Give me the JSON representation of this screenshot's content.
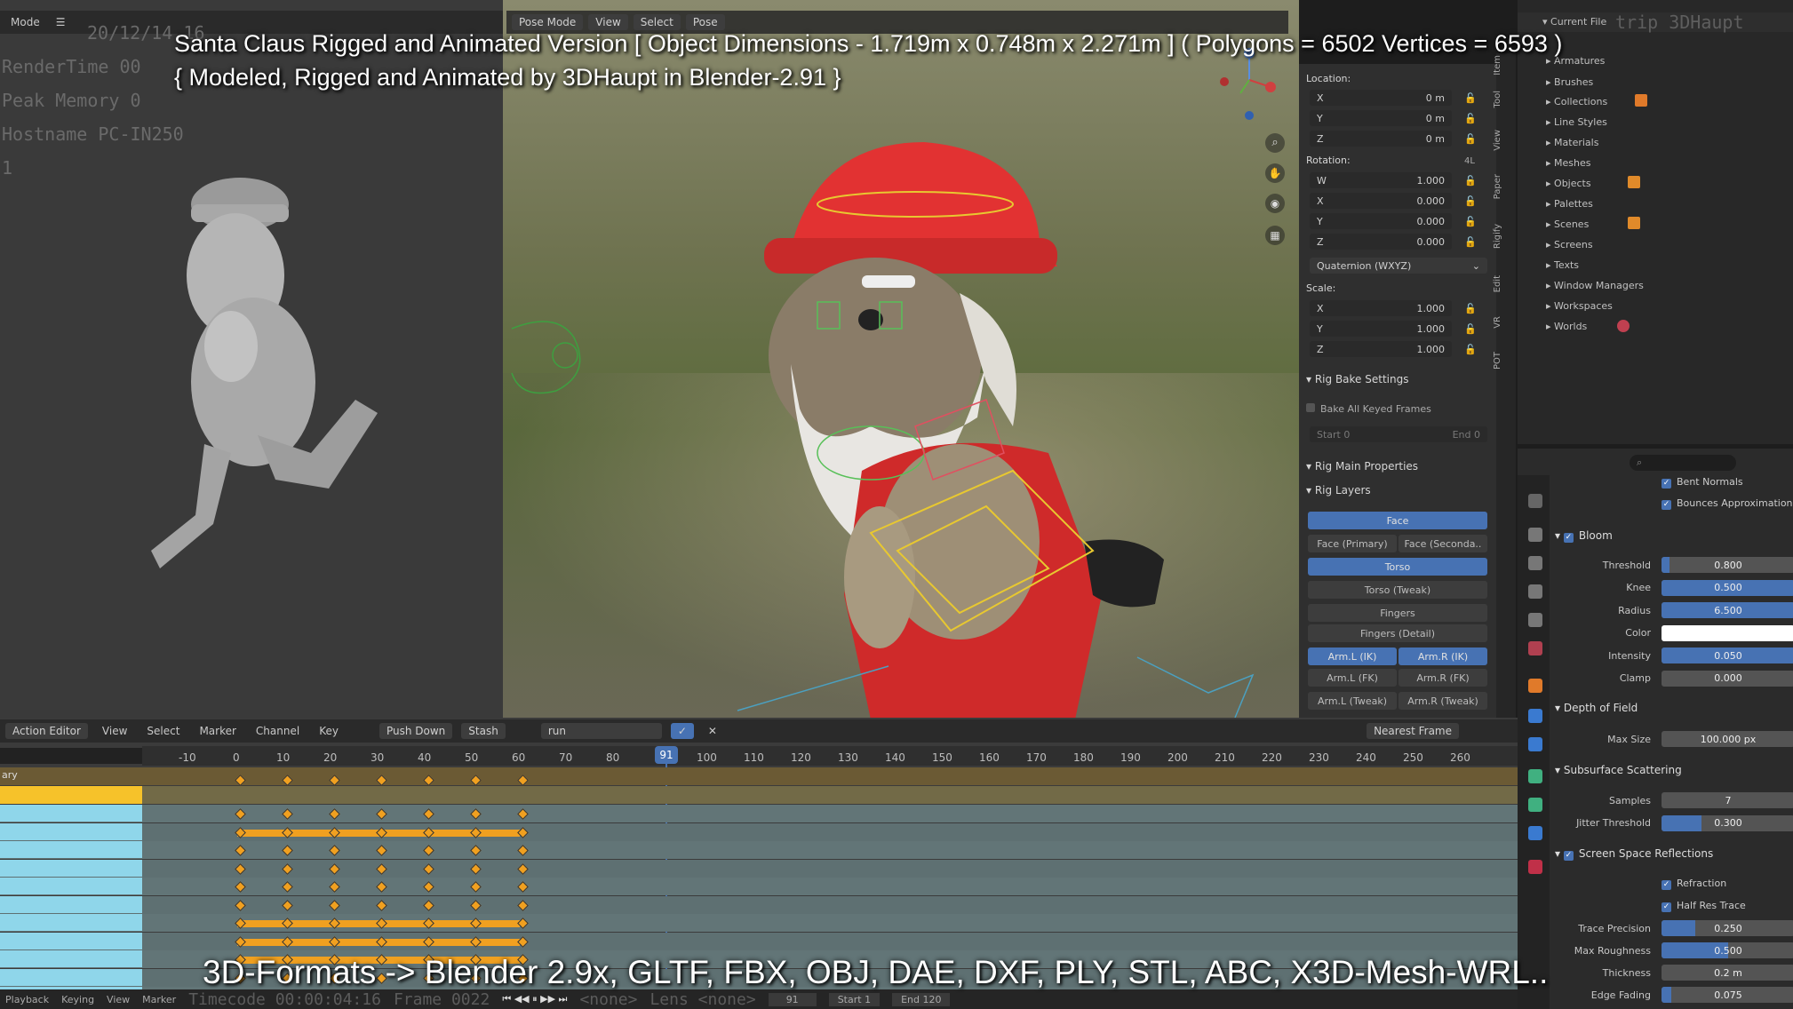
{
  "overlay": {
    "title_line1": "Santa Claus Rigged and Animated Version [ Object Dimensions -  1.719m x 0.748m x 2.271m ] ( Polygons = 6502  Vertices = 6593 )",
    "title_line2": "{ Modeled, Rigged and Animated by 3DHaupt in Blender-2.91 }",
    "formats_line": "3D-Formats -> Blender 2.9x, GLTF, FBX, OBJ, DAE, DXF, PLY, STL, ABC, X3D-Mesh-WRL.."
  },
  "render_stats": {
    "line1": "20/12/14 16",
    "line2": "RenderTime 00",
    "line3": "Peak Memory 0",
    "line4": "Hostname PC-IN250",
    "line5": "1",
    "right_note": "trip 3DHaupt"
  },
  "left_viewport": {
    "mode_label": "Mode"
  },
  "viewport_header": {
    "mode": "Pose Mode",
    "menus": [
      "View",
      "Select",
      "Pose"
    ]
  },
  "npanel": {
    "location_label": "Location:",
    "location": [
      [
        "X",
        "0 m"
      ],
      [
        "Y",
        "0 m"
      ],
      [
        "Z",
        "0 m"
      ]
    ],
    "rotation_label": "Rotation:",
    "rotation_mode_short": "4L",
    "rotation": [
      [
        "W",
        "1.000"
      ],
      [
        "X",
        "0.000"
      ],
      [
        "Y",
        "0.000"
      ],
      [
        "Z",
        "0.000"
      ]
    ],
    "rotation_mode": "Quaternion (WXYZ)",
    "scale_label": "Scale:",
    "scale": [
      [
        "X",
        "1.000"
      ],
      [
        "Y",
        "1.000"
      ],
      [
        "Z",
        "1.000"
      ]
    ],
    "bake_header": "Rig Bake Settings",
    "bake_all": "Bake All Keyed Frames",
    "bake_start": "Start",
    "bake_start_val": "0",
    "bake_end": "End",
    "bake_end_val": "0",
    "main_props_header": "Rig Main Properties",
    "layers_header": "Rig Layers",
    "layers": {
      "face": "Face",
      "face_primary": "Face (Primary)",
      "face_secondary": "Face (Seconda..",
      "torso": "Torso",
      "torso_tweak": "Torso (Tweak)",
      "fingers": "Fingers",
      "fingers_detail": "Fingers (Detail)",
      "arm_l_ik": "Arm.L (IK)",
      "arm_r_ik": "Arm.R (IK)",
      "arm_l_fk": "Arm.L (FK)",
      "arm_r_fk": "Arm.R (FK)",
      "arm_l_tweak": "Arm.L (Tweak)",
      "arm_r_tweak": "Arm.R (Tweak)"
    },
    "vtabs": [
      "Item",
      "Tool",
      "View",
      "Paper",
      "Rigify",
      "Edit",
      "VR",
      "POT"
    ]
  },
  "outliner": {
    "header": "Current File",
    "items": [
      "Armatures",
      "Brushes",
      "Collections",
      "Line Styles",
      "Materials",
      "Meshes",
      "Objects",
      "Palettes",
      "Scenes",
      "Screens",
      "Texts",
      "Window Managers",
      "Workspaces",
      "Worlds"
    ]
  },
  "properties": {
    "bent_normals": "Bent Normals",
    "bounces": "Bounces Approximation",
    "bloom": "Bloom",
    "bloom_rows": [
      {
        "label": "Threshold",
        "value": "0.800",
        "fill": 0.06
      },
      {
        "label": "Knee",
        "value": "0.500",
        "fill": 1.0
      },
      {
        "label": "Radius",
        "value": "6.500",
        "fill": 1.0
      },
      {
        "label": "Color",
        "value": "",
        "fill": 0
      },
      {
        "label": "Intensity",
        "value": "0.050",
        "fill": 1.0
      },
      {
        "label": "Clamp",
        "value": "0.000",
        "fill": 0
      }
    ],
    "dof": "Depth of Field",
    "dof_rows": [
      {
        "label": "Max Size",
        "value": "100.000 px",
        "fill": 0
      }
    ],
    "sss": "Subsurface Scattering",
    "sss_rows": [
      {
        "label": "Samples",
        "value": "7",
        "fill": 0
      },
      {
        "label": "Jitter Threshold",
        "value": "0.300",
        "fill": 0.3
      }
    ],
    "ssr": "Screen Space Reflections",
    "refraction": "Refraction",
    "half_res": "Half Res Trace",
    "ssr_rows": [
      {
        "label": "Trace Precision",
        "value": "0.250",
        "fill": 0.25
      },
      {
        "label": "Max Roughness",
        "value": "0.500",
        "fill": 0.5
      },
      {
        "label": "Thickness",
        "value": "0.2 m",
        "fill": 0
      },
      {
        "label": "Edge Fading",
        "value": "0.075",
        "fill": 0.07
      }
    ]
  },
  "timeline": {
    "editor": "Action Editor",
    "menus": [
      "View",
      "Select",
      "Marker",
      "Channel",
      "Key"
    ],
    "push_down": "Push Down",
    "stash": "Stash",
    "action": "run",
    "snap": "Nearest Frame",
    "frames": [
      "-10",
      "0",
      "10",
      "20",
      "30",
      "40",
      "50",
      "60",
      "70",
      "80",
      "91",
      "100",
      "110",
      "120",
      "130",
      "140",
      "150",
      "160",
      "170",
      "180",
      "190",
      "200",
      "210",
      "220",
      "230",
      "240",
      "250",
      "260"
    ],
    "current_frame": "91",
    "channel_first": "ary",
    "footer": {
      "playback": "Playback",
      "keying": "Keying",
      "view": "View",
      "marker": "Marker",
      "timecode": "Timecode 00:00:04:16",
      "frame_ghost": "Frame 0022",
      "none1": "<none>",
      "lens": "Lens <none>",
      "cur": "91",
      "start_label": "Start",
      "start": "1",
      "end_label": "End",
      "end": "120"
    }
  }
}
